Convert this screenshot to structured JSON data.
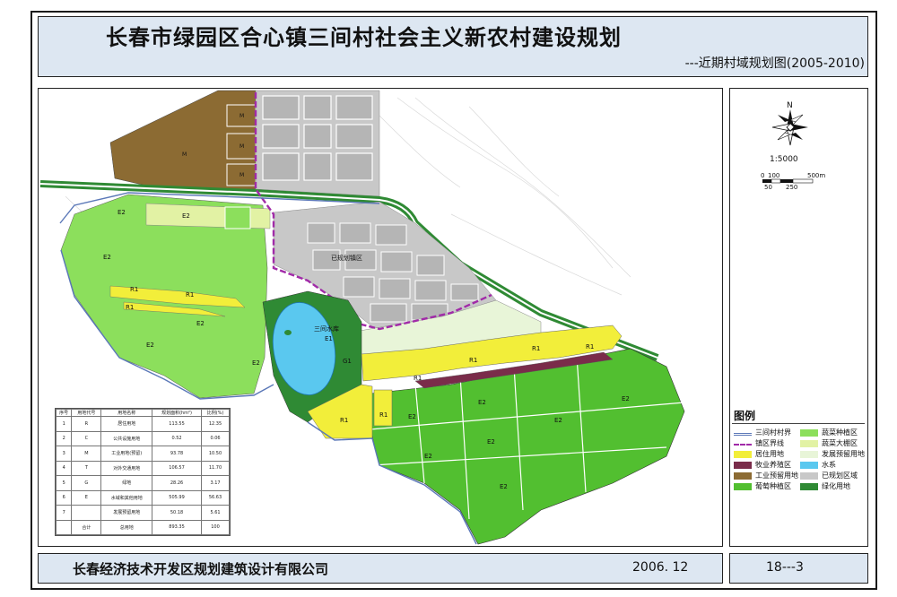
{
  "header": {
    "title": "长春市绿园区合心镇三间村社会主义新农村建设规划",
    "subtitle": "---近期村域规划图(2005-2010)"
  },
  "map": {
    "labels": {
      "reservoir_name": "三间水库",
      "planned_town": "已规划镇区",
      "industrial": "M",
      "greenland": "G1",
      "water": "E1",
      "residential": "R1",
      "vegetable": "E2"
    }
  },
  "north": {
    "letter": "N",
    "scale": "1:5000",
    "scale_ticks": [
      "0",
      "100",
      "500m",
      "50",
      "250"
    ]
  },
  "legend": {
    "title": "图例",
    "items": [
      {
        "label": "三间村村界",
        "color": "#5b78b8"
      },
      {
        "label": "蔬菜种植区",
        "color": "#8cdf5c"
      },
      {
        "label": "镇区界线",
        "color": "#a12ba8"
      },
      {
        "label": "蔬菜大棚区",
        "color": "#e2f2a4"
      },
      {
        "label": "居住用地",
        "color": "#f2ee3a"
      },
      {
        "label": "发展预留用地",
        "color": "#e8f5d8"
      },
      {
        "label": "牧业养殖区",
        "color": "#7a2c4a"
      },
      {
        "label": "水系",
        "color": "#5ac8ef"
      },
      {
        "label": "工业预留用地",
        "color": "#8c6b33"
      },
      {
        "label": "已规划区域",
        "color": "#c8c8c8"
      },
      {
        "label": "葡萄种植区",
        "color": "#52bf30"
      },
      {
        "label": "绿化用地",
        "color": "#2f8a34"
      }
    ]
  },
  "table": {
    "headers": [
      "序号",
      "用地代号",
      "用地名称",
      "规划面积(hm²)",
      "比例(%)"
    ],
    "rows": [
      [
        "1",
        "R",
        "居住用地",
        "113.55",
        "12.35"
      ],
      [
        "2",
        "C",
        "公共设施用地",
        "0.52",
        "0.06"
      ],
      [
        "3",
        "M",
        "工业用地(预留)",
        "93.78",
        "10.50"
      ],
      [
        "4",
        "T",
        "对外交通用地",
        "106.57",
        "11.70"
      ],
      [
        "5",
        "G",
        "绿地",
        "28.26",
        "3.17"
      ],
      [
        "6",
        "E",
        "水域和其他用地",
        "505.99",
        "56.63"
      ],
      [
        "7",
        "",
        "发展预留用地",
        "50.18",
        "5.61"
      ],
      [
        "",
        "合计",
        "总用地",
        "893.35",
        "100"
      ]
    ]
  },
  "footer": {
    "org": "长春经济技术开发区规划建筑设计有限公司",
    "date": "2006. 12",
    "sheet": "18---3"
  }
}
